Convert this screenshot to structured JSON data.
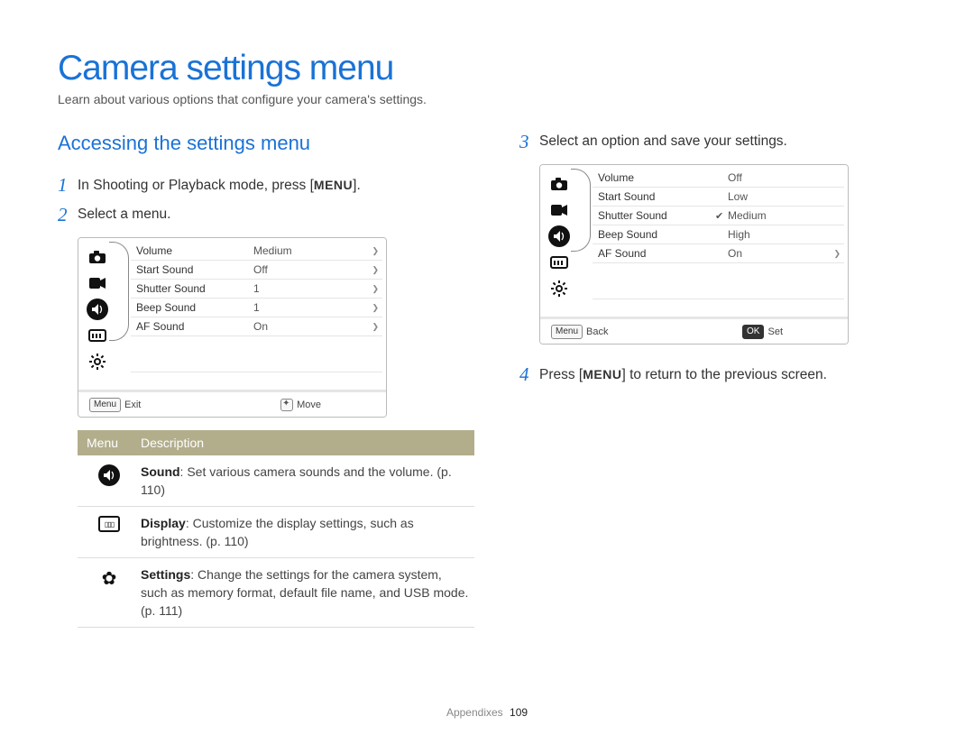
{
  "title": "Camera settings menu",
  "subtitle": "Learn about various options that configure your camera's settings.",
  "section_heading": "Accessing the settings menu",
  "steps": {
    "s1_a": "In Shooting or Playback mode, press [",
    "s1_key": "MENU",
    "s1_b": "].",
    "s2": "Select a menu.",
    "s3": "Select an option and save your settings.",
    "s4_a": "Press [",
    "s4_key": "MENU",
    "s4_b": "] to return to the previous screen."
  },
  "step_numbers": {
    "n1": "1",
    "n2": "2",
    "n3": "3",
    "n4": "4"
  },
  "icon_names": {
    "camera": "camera",
    "video": "video",
    "sound": "sound",
    "display": "display",
    "gear": "settings-gear"
  },
  "screen1": {
    "rows": [
      {
        "label": "Volume",
        "value": "Medium",
        "arrow": true
      },
      {
        "label": "Start Sound",
        "value": "Off",
        "arrow": true
      },
      {
        "label": "Shutter Sound",
        "value": "1",
        "arrow": true
      },
      {
        "label": "Beep Sound",
        "value": "1",
        "arrow": true
      },
      {
        "label": "AF Sound",
        "value": "On",
        "arrow": true
      }
    ],
    "footer": {
      "left_chip": "Menu",
      "left_text": "Exit",
      "right_text": "Move"
    }
  },
  "screen2": {
    "rows": [
      {
        "label": "Volume",
        "value": "Off",
        "checked": false,
        "arrow": false
      },
      {
        "label": "Start Sound",
        "value": "Low",
        "checked": false,
        "arrow": false
      },
      {
        "label": "Shutter Sound",
        "value": "Medium",
        "checked": true,
        "arrow": false
      },
      {
        "label": "Beep Sound",
        "value": "High",
        "checked": false,
        "arrow": false
      },
      {
        "label": "AF Sound",
        "value": "On",
        "checked": false,
        "arrow": true
      }
    ],
    "footer": {
      "left_chip": "Menu",
      "left_text": "Back",
      "right_chip": "OK",
      "right_text": "Set"
    }
  },
  "desc_table": {
    "header_menu": "Menu",
    "header_desc": "Description",
    "rows": [
      {
        "icon": "sound",
        "bold": "Sound",
        "text": ": Set various camera sounds and the volume. (p. 110)"
      },
      {
        "icon": "display",
        "bold": "Display",
        "text": ": Customize the display settings, such as brightness. (p. 110)"
      },
      {
        "icon": "gear",
        "bold": "Settings",
        "text": ": Change the settings for the camera system, such as memory format, default file name, and USB mode. (p. 111)"
      }
    ]
  },
  "footer": {
    "section": "Appendixes",
    "page": "109"
  }
}
